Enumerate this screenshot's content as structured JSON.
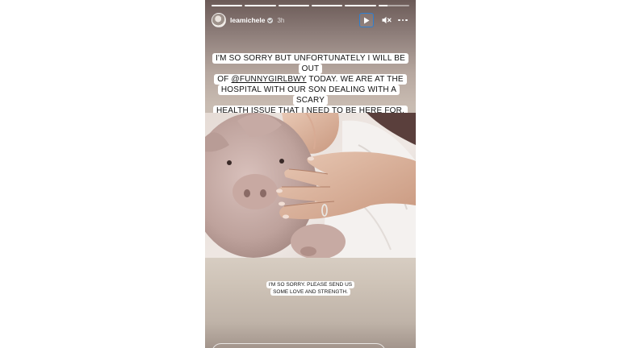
{
  "story": {
    "username": "leamichele",
    "time_ago": "3h",
    "progress_segments": [
      1,
      1,
      1,
      1,
      1,
      0.3
    ],
    "caption_main_lines": [
      "I'M SO SORRY BUT UNFORTUNATELY I WILL BE OUT",
      "OF ",
      "HOSPITAL WITH OUR SON DEALING WITH A SCARY",
      "HEALTH ISSUE THAT I NEED TO BE HERE FOR."
    ],
    "caption_mention": "@FUNNYGIRLBWY",
    "caption_line2_rest": " TODAY. WE ARE AT THE",
    "caption_secondary_lines": [
      "I'M SO SORRY. PLEASE SEND US",
      "SOME LOVE AND STRENGTH."
    ],
    "icons": {
      "play": "play-icon",
      "sound": "speaker-muted-icon",
      "more": "more-dots-icon",
      "verified": "verified-badge-icon"
    },
    "colors": {
      "accent_focus": "#2d7fd0"
    }
  }
}
